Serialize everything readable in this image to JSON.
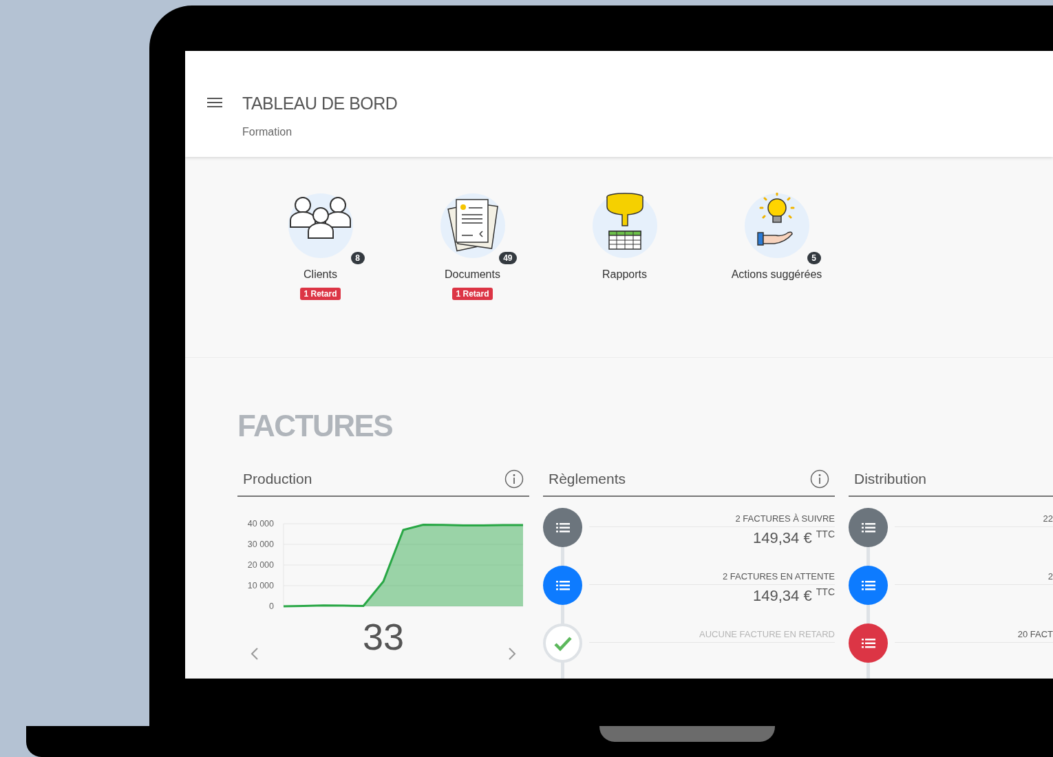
{
  "header": {
    "title": "TABLEAU DE BORD",
    "subtitle": "Formation"
  },
  "shortcuts": [
    {
      "kind": "clients",
      "label": "Clients",
      "count": "8",
      "tag": "1 Retard"
    },
    {
      "kind": "documents",
      "label": "Documents",
      "count": "49",
      "tag": "1 Retard"
    },
    {
      "kind": "reports",
      "label": "Rapports"
    },
    {
      "kind": "actions",
      "label": "Actions suggérées",
      "count": "5"
    }
  ],
  "section_title": "FACTURES",
  "panels": [
    {
      "kind": "chart",
      "title": "Production",
      "info": true,
      "total": "33",
      "chart_data": {
        "type": "area",
        "grid": true,
        "ylim": [
          0,
          40000
        ],
        "yticks": [
          {
            "value": 0,
            "label": "0"
          },
          {
            "value": 10000,
            "label": "10 000"
          },
          {
            "value": 20000,
            "label": "20 000"
          },
          {
            "value": 30000,
            "label": "30 000"
          },
          {
            "value": 40000,
            "label": "40 000"
          }
        ],
        "series": [
          {
            "color": "#28a745",
            "values": [
              0,
              200,
              400,
              300,
              200,
              12000,
              37000,
              39500,
              39400,
              39200,
              39200,
              39300,
              39300
            ]
          }
        ]
      }
    },
    {
      "kind": "timeline",
      "title": "Règlements",
      "info": true,
      "items": [
        {
          "kind": "list",
          "color": "#6c757d",
          "label": "2 FACTURES À SUIVRE",
          "amount": "149,34 €",
          "unit": "TTC"
        },
        {
          "kind": "list",
          "color": "#0d7bff",
          "label": "2 FACTURES EN ATTENTE",
          "amount": "149,34 €",
          "unit": "TTC"
        },
        {
          "kind": "check",
          "label": "AUCUNE FACTURE EN RETARD"
        }
      ]
    },
    {
      "kind": "timeline",
      "title": "Distribution",
      "info": false,
      "items": [
        {
          "kind": "list",
          "color": "#6c757d",
          "label": "22"
        },
        {
          "kind": "list",
          "color": "#0d7bff",
          "label": "2"
        },
        {
          "kind": "list",
          "color": "#dc3545",
          "label": "20 FACT"
        }
      ]
    }
  ]
}
